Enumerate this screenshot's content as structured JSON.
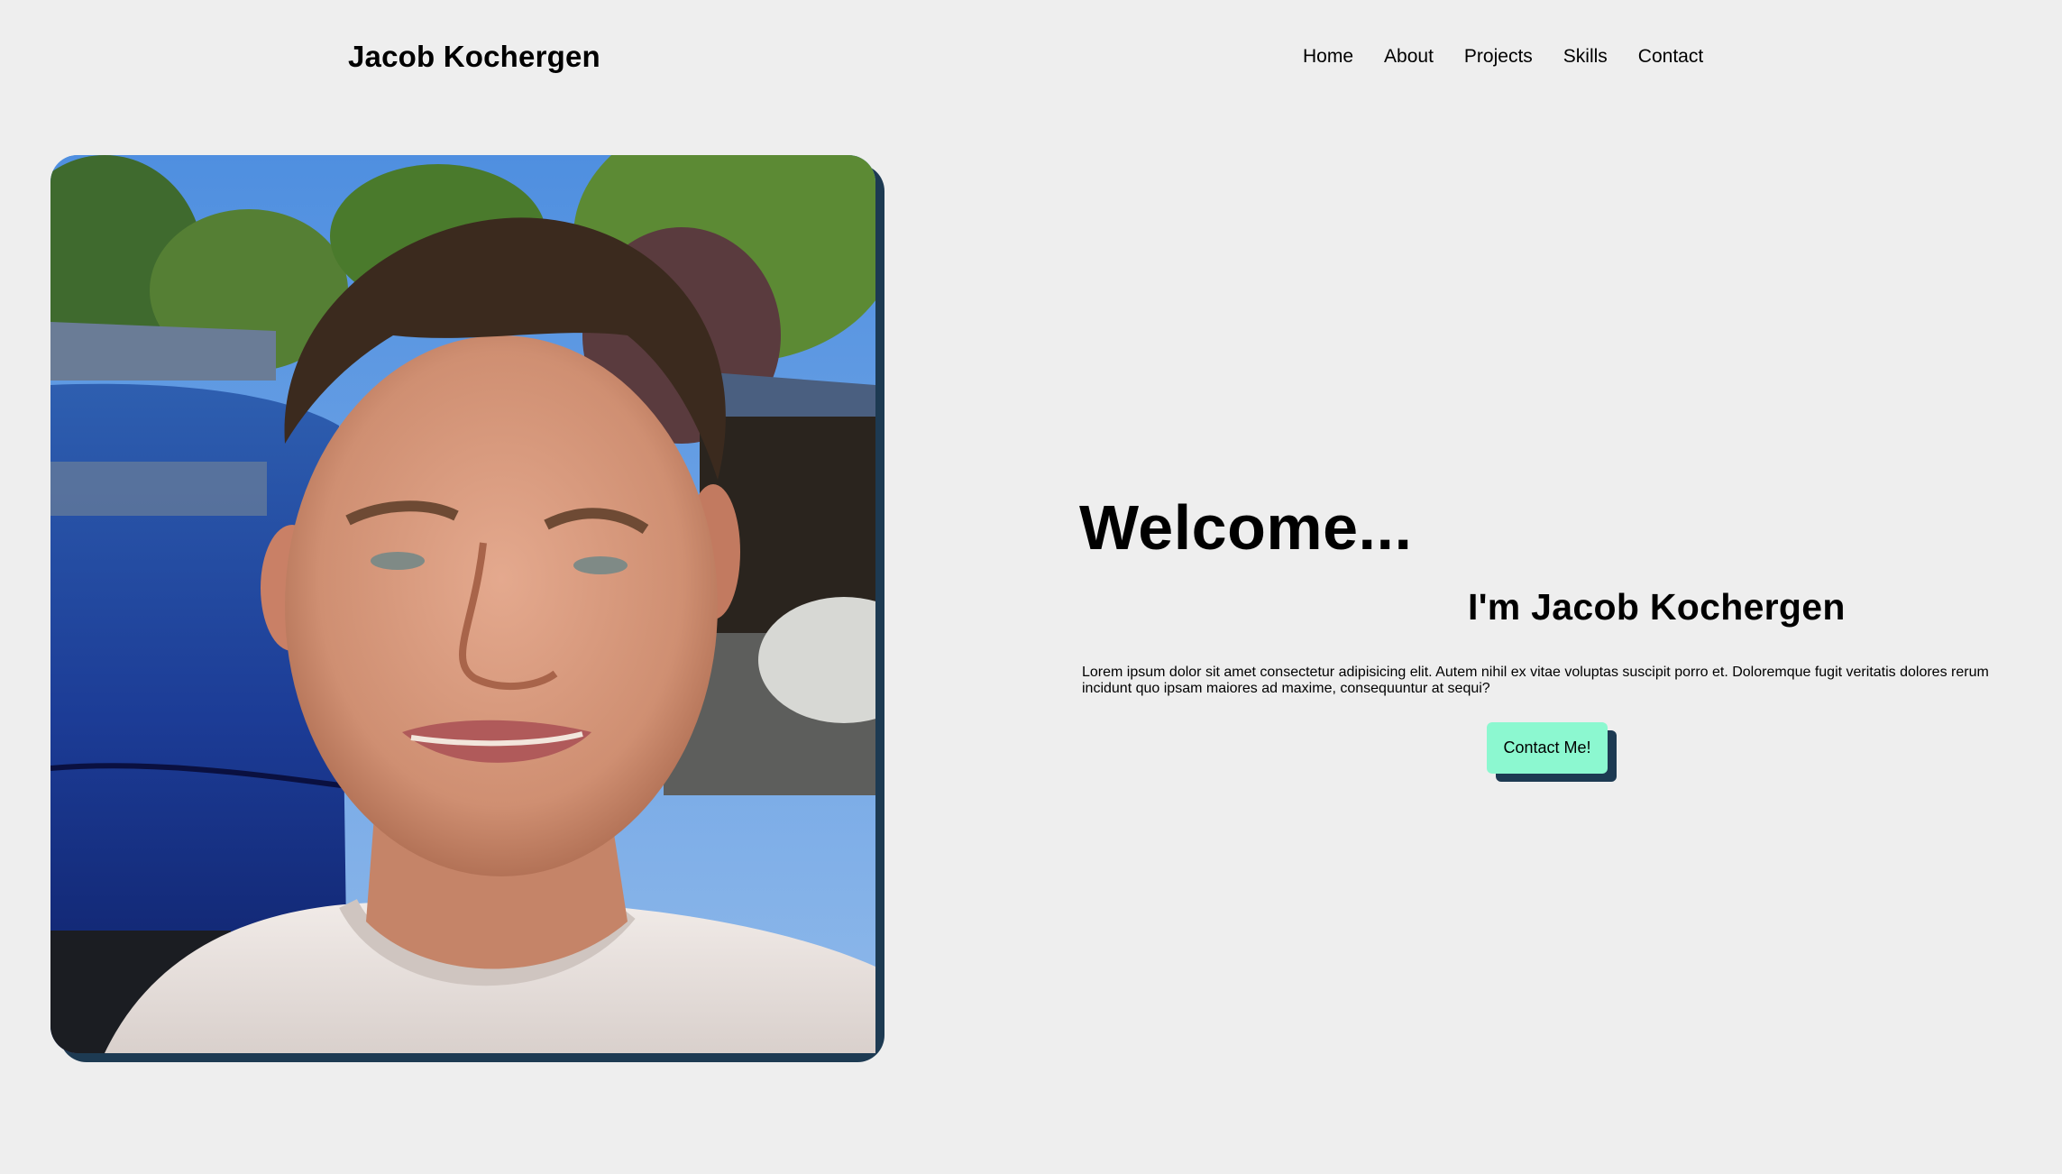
{
  "header": {
    "brand": "Jacob Kochergen",
    "nav": [
      "Home",
      "About",
      "Projects",
      "Skills",
      "Contact"
    ]
  },
  "hero": {
    "welcome": "Welcome...",
    "intro": "I'm Jacob Kochergen",
    "description": "Lorem ipsum dolor sit amet consectetur adipisicing elit. Autem nihil ex vitae voluptas suscipit porro et. Doloremque fugit veritatis dolores rerum incidunt quo ipsam maiores ad maxime, consequuntur at sequi?",
    "cta_label": "Contact Me!"
  },
  "colors": {
    "background": "#eeeeee",
    "accent_shadow": "#1d3a52",
    "button": "#8cf8d0"
  }
}
